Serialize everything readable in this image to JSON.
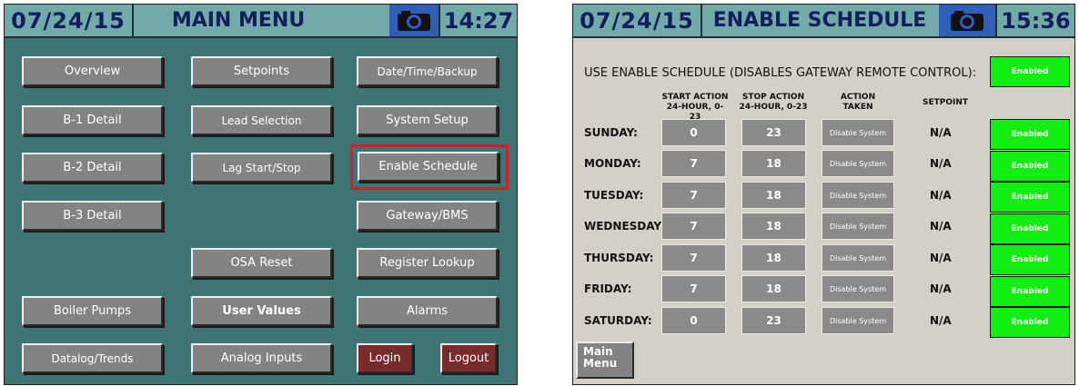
{
  "colors": {
    "panel_teal": "#3f7474",
    "header_teal": "#73a9a9",
    "title_navy": "#0f1f5a",
    "camera_blue": "#2f5fb9",
    "button_gray": "#838383",
    "login_red": "#7a2b2b",
    "highlight_red": "#d4202a",
    "enabled_green": "#12ee12",
    "right_bg": "#d4d0c8"
  },
  "left_screen": {
    "date": "07/24/15",
    "title": "MAIN MENU",
    "camera_icon": "camera-icon",
    "time": "14:27",
    "buttons": [
      {
        "label": "Overview"
      },
      {
        "label": "Setpoints"
      },
      {
        "label": "Date/Time/Backup"
      },
      {
        "label": "B-1 Detail"
      },
      {
        "label": "Lead Selection"
      },
      {
        "label": "System Setup"
      },
      {
        "label": "B-2 Detail"
      },
      {
        "label": "Lag Start/Stop"
      },
      {
        "label": "Enable Schedule"
      },
      {
        "label": "B-3 Detail"
      },
      {
        "label": "Gateway/BMS"
      },
      {
        "label": "OSA Reset"
      },
      {
        "label": "Register Lookup"
      },
      {
        "label": "Boiler Pumps"
      },
      {
        "label": "User Values"
      },
      {
        "label": "Alarms"
      },
      {
        "label": "Datalog/Trends"
      },
      {
        "label": "Analog Inputs"
      },
      {
        "label": "Login"
      },
      {
        "label": "Logout"
      }
    ]
  },
  "right_screen": {
    "date": "07/24/15",
    "title": "ENABLE SCHEDULE",
    "camera_icon": "camera-icon",
    "time": "15:36",
    "enable_line": "USE ENABLE SCHEDULE (DISABLES GATEWAY REMOTE CONTROL):",
    "enable_status": "Enabled",
    "col_start_1": "START ACTION",
    "col_start_2": "24-HOUR, 0-23",
    "col_stop_1": "STOP ACTION",
    "col_stop_2": "24-HOUR, 0-23",
    "col_action_1": "ACTION",
    "col_action_2": "TAKEN",
    "col_setpoint": "SETPOINT",
    "rows": [
      {
        "day": "SUNDAY:",
        "start": "0",
        "stop": "23",
        "action": "Disable System",
        "setpoint": "N/A",
        "status": "Enabled"
      },
      {
        "day": "MONDAY:",
        "start": "7",
        "stop": "18",
        "action": "Disable System",
        "setpoint": "N/A",
        "status": "Enabled"
      },
      {
        "day": "TUESDAY:",
        "start": "7",
        "stop": "18",
        "action": "Disable System",
        "setpoint": "N/A",
        "status": "Enabled"
      },
      {
        "day": "WEDNESDAY:",
        "start": "7",
        "stop": "18",
        "action": "Disable System",
        "setpoint": "N/A",
        "status": "Enabled"
      },
      {
        "day": "THURSDAY:",
        "start": "7",
        "stop": "18",
        "action": "Disable System",
        "setpoint": "N/A",
        "status": "Enabled"
      },
      {
        "day": "FRIDAY:",
        "start": "7",
        "stop": "18",
        "action": "Disable System",
        "setpoint": "N/A",
        "status": "Enabled"
      },
      {
        "day": "SATURDAY:",
        "start": "0",
        "stop": "23",
        "action": "Disable System",
        "setpoint": "N/A",
        "status": "Enabled"
      }
    ],
    "main_menu_1": "Main",
    "main_menu_2": "Menu"
  }
}
